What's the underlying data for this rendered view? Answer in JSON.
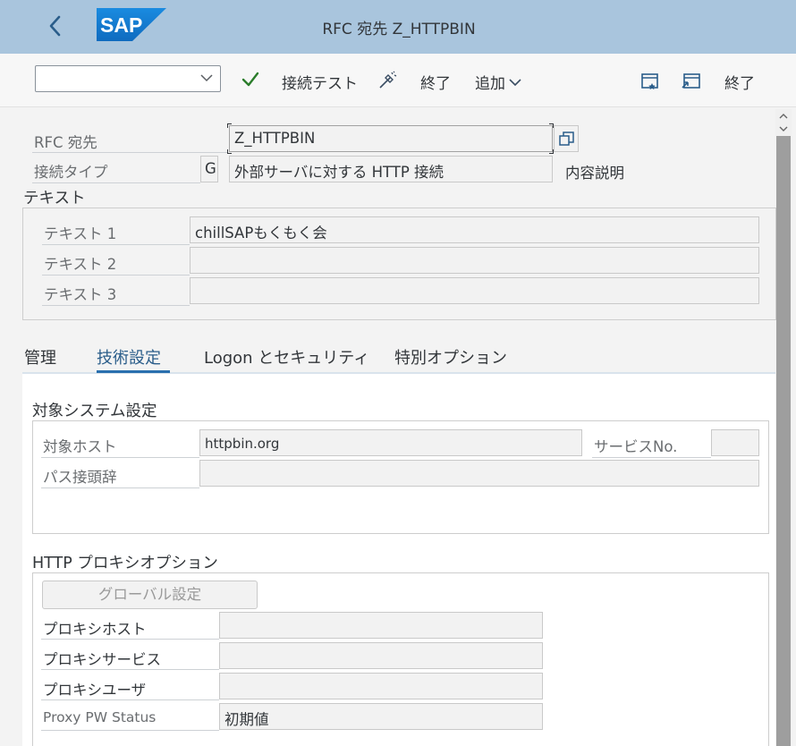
{
  "header": {
    "title": "RFC 宛先 Z_HTTPBIN",
    "logo": "SAP"
  },
  "toolbar": {
    "select_value": "",
    "conn_test": "接続テスト",
    "end1": "終了",
    "add": "追加",
    "end2": "終了"
  },
  "form": {
    "rfc_dest_label": "RFC 宛先",
    "rfc_dest_value": "Z_HTTPBIN",
    "conn_type_label": "接続タイプ",
    "conn_type_code": "G",
    "conn_type_desc": "外部サーバに対する HTTP 接続",
    "desc_label": "内容説明"
  },
  "text_section": {
    "title": "テキスト",
    "rows": [
      {
        "label": "テキスト 1",
        "value": "chillSAPもくもく会"
      },
      {
        "label": "テキスト 2",
        "value": ""
      },
      {
        "label": "テキスト 3",
        "value": ""
      }
    ]
  },
  "tabs": [
    "管理",
    "技術設定",
    "Logon とセキュリティ",
    "特別オプション"
  ],
  "target_system": {
    "title": "対象システム設定",
    "host_label": "対象ホスト",
    "host_value": "httpbin.org",
    "service_label": "サービスNo.",
    "service_value": "",
    "path_label": "パス接頭辞",
    "path_value": ""
  },
  "proxy": {
    "title": "HTTP プロキシオプション",
    "global_button": "グローバル設定",
    "host_label": "プロキシホスト",
    "host_value": "",
    "service_label": "プロキシサービス",
    "service_value": "",
    "user_label": "プロキシユーザ",
    "user_value": "",
    "pw_label": "Proxy PW Status",
    "pw_value": "初期値"
  },
  "colors": {
    "header_bg": "#a9c5dd",
    "logo_blue": "#1a7dd4",
    "check_green": "#2b7d2b",
    "tab_active": "#2a6fae"
  }
}
